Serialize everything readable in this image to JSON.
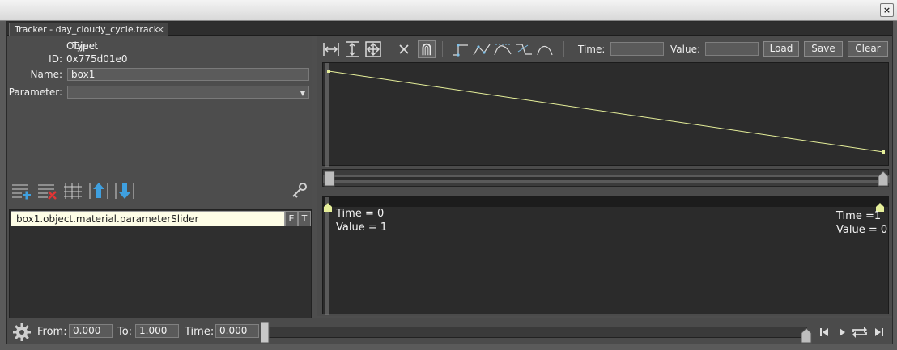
{
  "window": {
    "tab_title": "Tracker - day_cloudy_cycle.track",
    "tab_close": "×",
    "close_glyph": "×"
  },
  "background": {
    "ghost_a": "",
    "ghost_b": ""
  },
  "object": {
    "type_label": "Type:",
    "type_value": "Object",
    "id_label": "ID:",
    "id_value": "0x775d01e0",
    "name_label": "Name:",
    "name_value": "box1",
    "param_label": "Parameter:",
    "param_value": ""
  },
  "tracks": {
    "items": [
      {
        "label": "box1.object.material.parameterSlider",
        "e": "E",
        "t": "T"
      }
    ],
    "icons": [
      "add-track-icon",
      "remove-track-icon",
      "columns-icon",
      "move-up-icon",
      "move-down-icon",
      "key-icon"
    ]
  },
  "toolbar": {
    "time_label": "Time:",
    "time_value": "",
    "value_label": "Value:",
    "value_value": "",
    "load": "Load",
    "save": "Save",
    "clear": "Clear"
  },
  "curve": {
    "start_value": 1,
    "end_value": 0,
    "color": "#e6ef9a"
  },
  "keys": [
    {
      "time_text": "Time = 0",
      "value_text": "Value = 1",
      "time": 0,
      "value": 1
    },
    {
      "time_text": "Time =1",
      "value_text": "Value = 0",
      "time": 1,
      "value": 0
    }
  ],
  "timeline": {
    "from_label": "From:",
    "from_value": "0.000",
    "to_label": "To:",
    "to_value": "1.000",
    "time_label": "Time:",
    "time_value": "0.000",
    "position": 0
  }
}
